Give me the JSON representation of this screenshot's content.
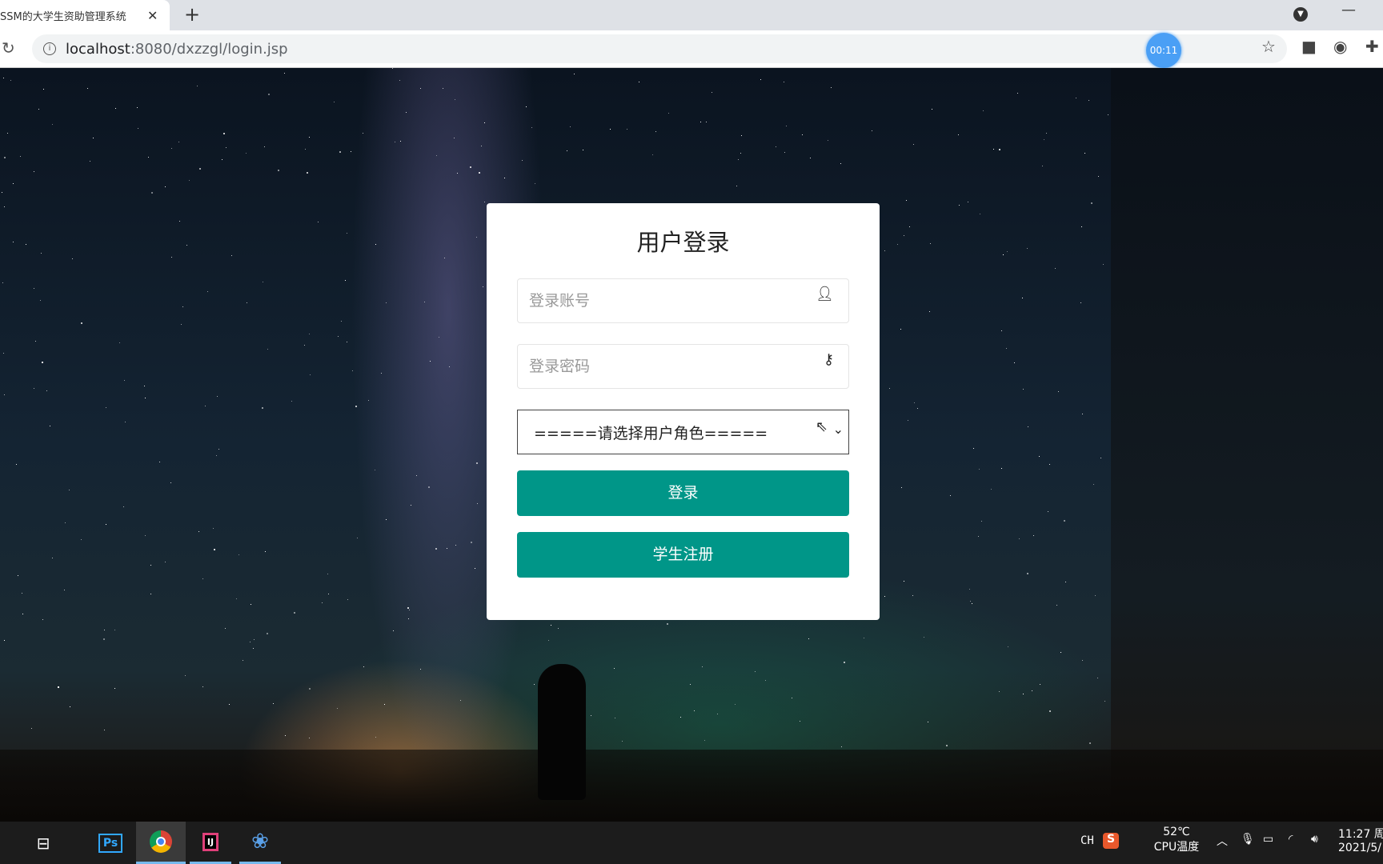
{
  "browser": {
    "tab_title": "SSM的大学生资助管理系统",
    "url_host": "localhost",
    "url_rest": ":8080/dxzzgl/login.jsp",
    "recording_timer": "00:11"
  },
  "login": {
    "title": "用户登录",
    "account_placeholder": "登录账号",
    "password_placeholder": "登录密码",
    "role_selected": "=====请选择用户角色=====",
    "login_label": "登录",
    "register_label": "学生注册",
    "button_color": "#009688"
  },
  "taskbar": {
    "ime": "CH",
    "cpu_temp": "52℃",
    "cpu_label": "CPU温度",
    "time": "11:27 周",
    "date": "2021/5/"
  }
}
